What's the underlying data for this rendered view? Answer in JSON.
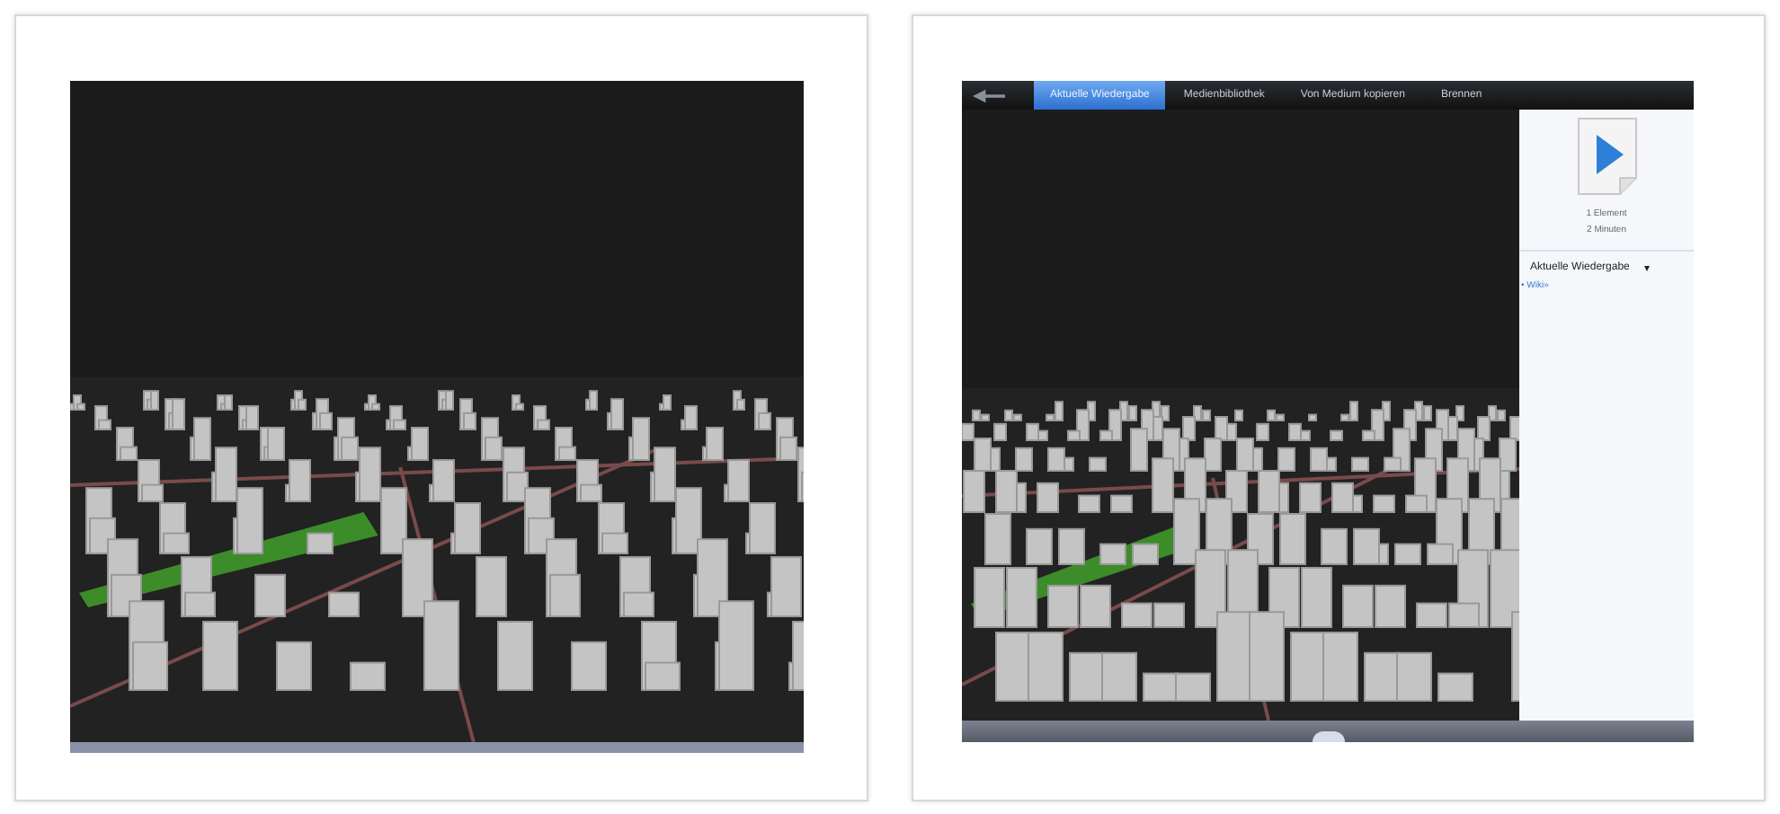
{
  "player": {
    "tabs": [
      {
        "label": "Aktuelle Wiedergabe",
        "selected": true
      },
      {
        "label": "Medienbibliothek",
        "selected": false
      },
      {
        "label": "Von Medium kopieren",
        "selected": false
      },
      {
        "label": "Brennen",
        "selected": false
      }
    ],
    "side_panel": {
      "item_count": "1 Element",
      "duration": "2 Minuten",
      "list_title": "Aktuelle Wiedergabe",
      "list_caret": "▾",
      "list_link": "• Wiki»"
    }
  }
}
